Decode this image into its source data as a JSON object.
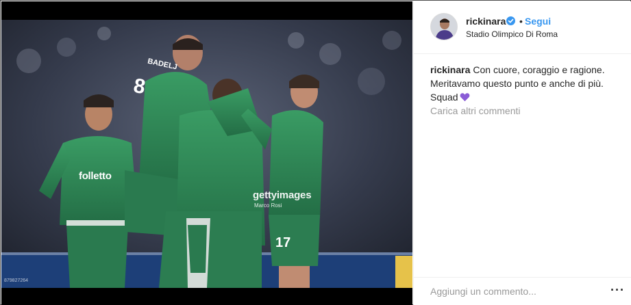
{
  "post": {
    "username": "rickinara",
    "verified": true,
    "separator": "•",
    "follow_label": "Segui",
    "location": "Stadio Olimpico Di Roma",
    "caption_text": "Con cuore, coraggio e ragione. Meritavamo questo punto e anche di più. Squad",
    "load_more_label": "Carica altri commenti",
    "comment_placeholder": "Aggiungi un commento...",
    "options_label": "···"
  },
  "photo": {
    "watermark": "gettyimages",
    "watermark_credit": "Marco Rosi",
    "image_id": "879827264",
    "sponsor": "folletto",
    "jersey_numbers": [
      "8",
      "17"
    ],
    "jersey_name": "BADELJ"
  },
  "colors": {
    "link": "#3897f0",
    "text": "#262626",
    "secondary": "#999999",
    "jersey_green": "#2e8a57",
    "heart": "#8a5cd6"
  }
}
